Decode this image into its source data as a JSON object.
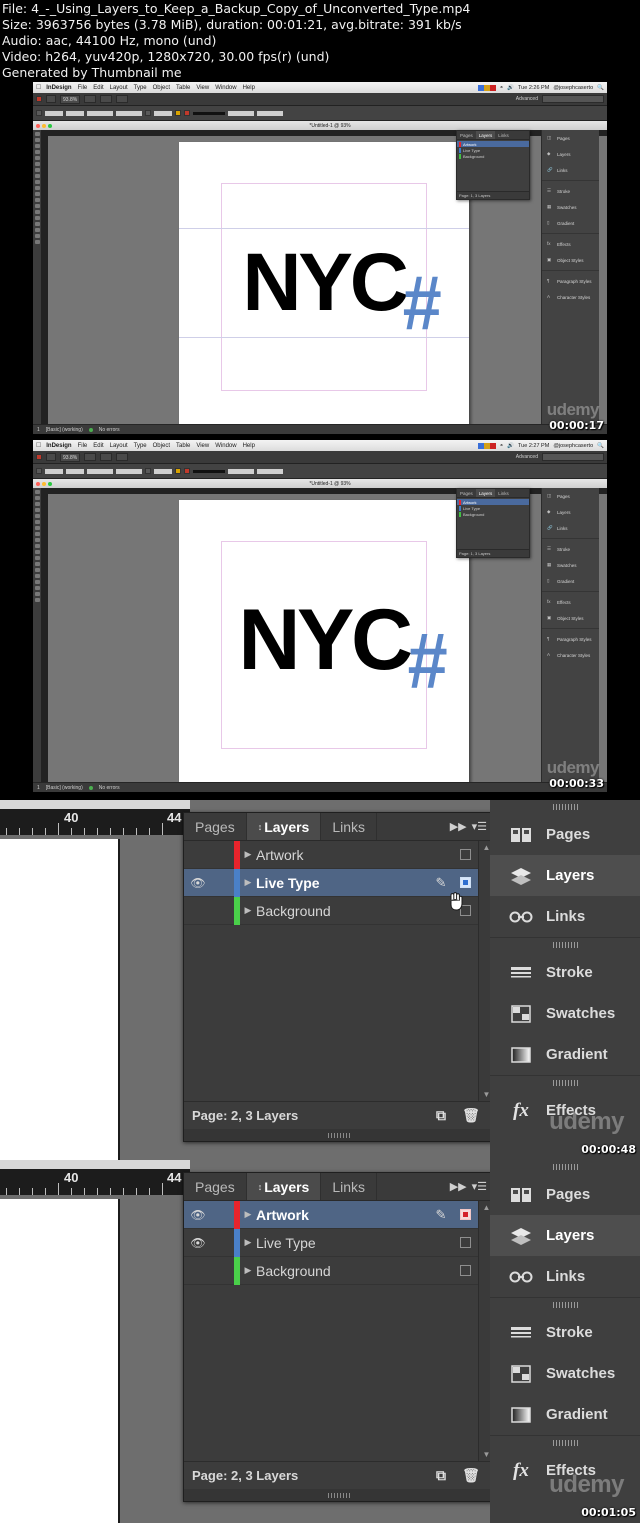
{
  "info": {
    "line1": "File: 4_-_Using_Layers_to_Keep_a_Backup_Copy_of_Unconverted_Type.mp4",
    "line2": "Size: 3963756 bytes (3.78 MiB), duration: 00:01:21, avg.bitrate: 391 kb/s",
    "line3": "Audio: aac, 44100 Hz, mono (und)",
    "line4": "Video: h264, yuv420p, 1280x720, 30.00 fps(r) (und)",
    "line5": "Generated by Thumbnail me"
  },
  "app": {
    "menu_items": [
      "InDesign",
      "File",
      "Edit",
      "Layout",
      "Type",
      "Object",
      "Table",
      "View",
      "Window",
      "Help"
    ],
    "doc_title": "*Untitled-1 @ 93%",
    "zoom_level": "93.8%",
    "workspace": "Advanced",
    "status_text": "[Basic] (working)",
    "status_errors": "No errors"
  },
  "thumbnails": [
    {
      "timestamp": "00:00:17",
      "clock": "Tue 2:26 PM",
      "user": "@josephcaserto"
    },
    {
      "timestamp": "00:00:33",
      "clock": "Tue 2:27 PM",
      "user": "@josephcaserto"
    },
    {
      "timestamp": "00:00:48"
    },
    {
      "timestamp": "00:01:05"
    }
  ],
  "artwork": {
    "title": "NYC",
    "hash": "#",
    "title_color": "#000000",
    "hash_color": "#5b87c9"
  },
  "layers_panel": {
    "tabs": [
      {
        "label": "Pages",
        "active": false
      },
      {
        "label": "Layers",
        "active": true
      },
      {
        "label": "Links",
        "active": false
      }
    ],
    "collapse_icon": "▶▶",
    "menu_icon": "▾☰",
    "footer_text": "Page: 2, 3 Layers",
    "footer_icons": [
      "new-layer-icon",
      "delete-layer-icon"
    ],
    "scroll_up": "▲",
    "scroll_down": "▼"
  },
  "layers_state_a": {
    "rows": [
      {
        "name": "Artwork",
        "color": "#e8242c",
        "visible": false,
        "selected": false,
        "target": "off"
      },
      {
        "name": "Live Type",
        "color": "#4a80c8",
        "visible": true,
        "selected": true,
        "target": "blue"
      },
      {
        "name": "Background",
        "color": "#4ad04a",
        "visible": false,
        "selected": false,
        "target": "off"
      }
    ]
  },
  "layers_state_b": {
    "rows": [
      {
        "name": "Artwork",
        "color": "#e8242c",
        "visible": true,
        "selected": true,
        "target": "red"
      },
      {
        "name": "Live Type",
        "color": "#4a80c8",
        "visible": true,
        "selected": false,
        "target": "off"
      },
      {
        "name": "Background",
        "color": "#4ad04a",
        "visible": false,
        "selected": false,
        "target": "off"
      }
    ]
  },
  "dock": {
    "groups": [
      {
        "items": [
          {
            "label": "Pages",
            "icon": "pages-icon",
            "active": false
          },
          {
            "label": "Layers",
            "icon": "layers-icon",
            "active": true
          },
          {
            "label": "Links",
            "icon": "links-icon",
            "active": false
          }
        ]
      },
      {
        "items": [
          {
            "label": "Stroke",
            "icon": "stroke-icon",
            "active": false
          },
          {
            "label": "Swatches",
            "icon": "swatches-icon",
            "active": false
          },
          {
            "label": "Gradient",
            "icon": "gradient-icon",
            "active": false
          }
        ]
      },
      {
        "items": [
          {
            "label": "Effects",
            "icon": "effects-icon",
            "active": false
          }
        ]
      }
    ],
    "mini_items": [
      "Pages",
      "Layers",
      "Links",
      "Stroke",
      "Swatches",
      "Gradient",
      "Effects",
      "Object Styles",
      "Paragraph Styles",
      "Character Styles"
    ]
  },
  "ruler": {
    "marks": [
      "40",
      "44"
    ]
  },
  "watermark": "udemy"
}
